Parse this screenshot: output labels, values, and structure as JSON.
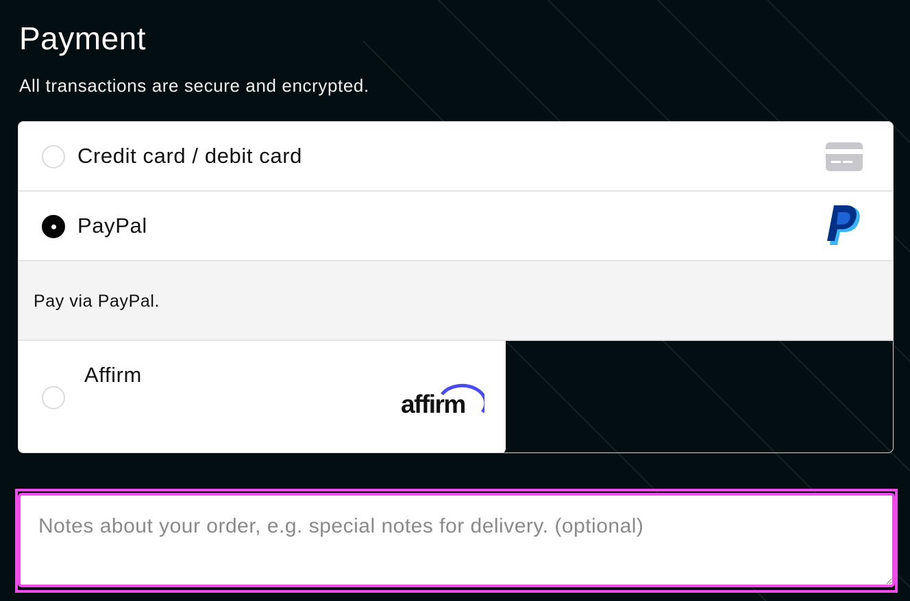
{
  "page": {
    "title": "Payment",
    "subtitle": "All transactions are secure and encrypted."
  },
  "payment_methods": [
    {
      "label": "Credit card / debit card",
      "selected": false,
      "icon": "credit-card-icon"
    },
    {
      "label": "PayPal",
      "selected": true,
      "icon": "paypal-icon",
      "description": "Pay via PayPal."
    },
    {
      "label": "Affirm",
      "selected": false,
      "icon": "affirm-logo",
      "logo_text": "affirm"
    }
  ],
  "notes": {
    "placeholder": "Notes about your order, e.g. special notes for delivery. (optional)",
    "value": ""
  },
  "colors": {
    "background": "#030e13",
    "focus_ring": "#ef4dea",
    "paypal_dark": "#003087",
    "paypal_light": "#3ab4f5",
    "affirm_arc": "#4a4af4"
  }
}
